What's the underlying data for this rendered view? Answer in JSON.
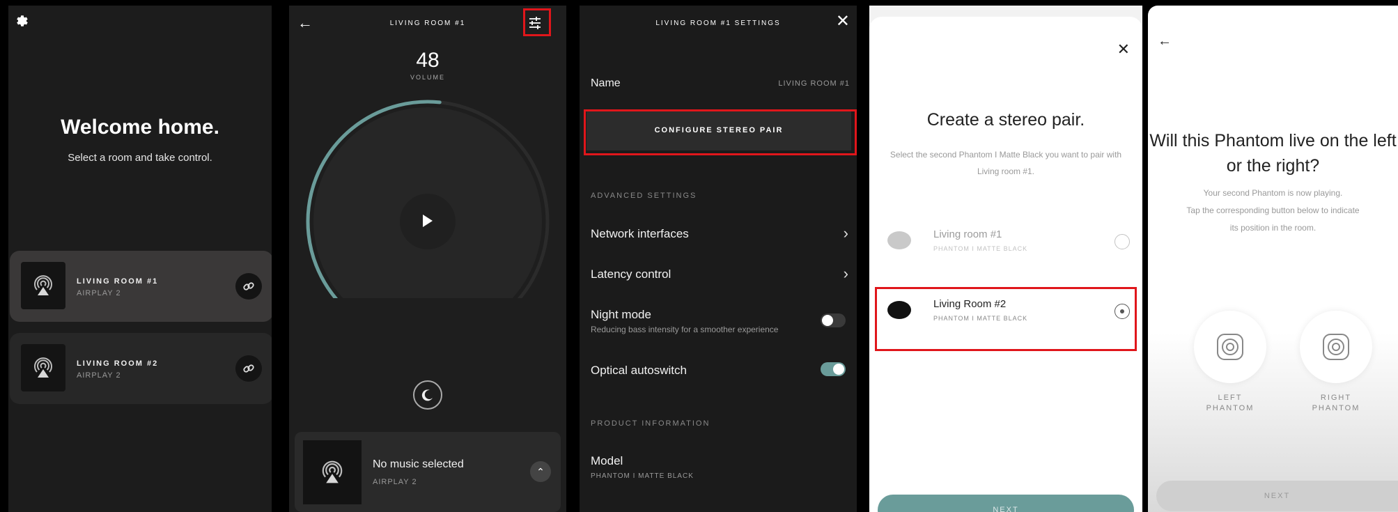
{
  "screen1": {
    "title": "Welcome home.",
    "subtitle": "Select a room and take control.",
    "rooms": [
      {
        "name": "LIVING ROOM #1",
        "source": "AIRPLAY 2"
      },
      {
        "name": "LIVING ROOM #2",
        "source": "AIRPLAY 2"
      }
    ],
    "icons": {
      "settings": "gear-icon",
      "link": "link-icon",
      "art": "airplay-icon"
    }
  },
  "screen2": {
    "title": "LIVING ROOM #1",
    "volume": "48",
    "volume_label": "VOLUME",
    "volume_level": 0.48,
    "now_playing": {
      "title": "No music selected",
      "source": "AIRPLAY 2"
    },
    "icons": {
      "back": "back-arrow-icon",
      "settings": "sliders-icon",
      "play": "play-icon",
      "night": "moon-icon",
      "expand": "chevron-up-icon"
    }
  },
  "screen3": {
    "title": "LIVING ROOM #1 SETTINGS",
    "name_label": "Name",
    "name_value": "LIVING ROOM #1",
    "configure_button": "CONFIGURE STEREO PAIR",
    "advanced_header": "ADVANCED SETTINGS",
    "network_label": "Network interfaces",
    "latency_label": "Latency control",
    "night_label": "Night mode",
    "night_desc": "Reducing bass intensity for a smoother experience",
    "night_on": false,
    "optical_label": "Optical autoswitch",
    "optical_on": true,
    "product_header": "PRODUCT INFORMATION",
    "model_label": "Model",
    "model_value": "PHANTOM I MATTE BLACK",
    "accent": "#6a9c9a"
  },
  "screen4": {
    "title": "Create a stereo pair.",
    "description": "Select the second Phantom I Matte Black you want to pair with Living room #1.",
    "speakers": [
      {
        "name": "Living room #1",
        "model": "PHANTOM I MATTE BLACK"
      },
      {
        "name": "Living Room #2",
        "model": "PHANTOM I MATTE BLACK"
      }
    ],
    "next_button": "NEXT"
  },
  "screen5": {
    "title": "Will this Phantom live on the left or the right?",
    "line1": "Your second Phantom is now playing.",
    "line2": "Tap the corresponding button below to indicate",
    "line3": "its position in the room.",
    "left_label": "LEFT PHANTOM",
    "right_label": "RIGHT PHANTOM",
    "next_button": "NEXT"
  },
  "colors": {
    "highlight": "#e0161b",
    "accent": "#6a9c9a"
  }
}
